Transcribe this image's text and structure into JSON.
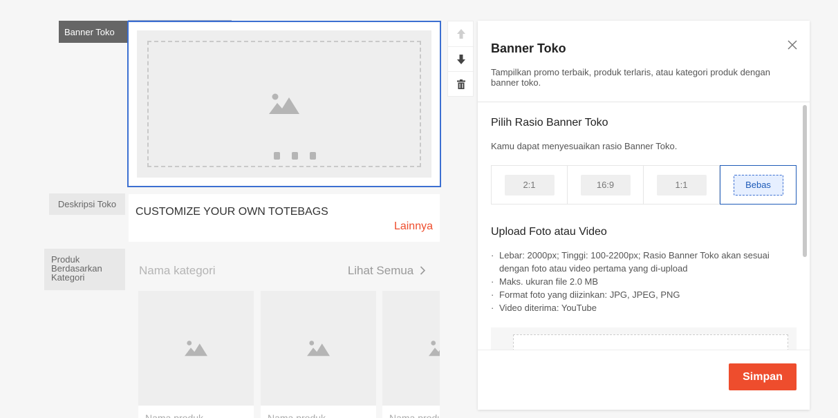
{
  "side_labels": {
    "banner": "Banner Toko",
    "description": "Deskripsi Toko",
    "products": "Produk\nBerdasarkan\nKategori"
  },
  "toolbar": {
    "up_icon": "arrow-up-icon",
    "down_icon": "arrow-down-icon",
    "delete_icon": "trash-icon"
  },
  "description_block": {
    "title": "CUSTOMIZE YOUR OWN TOTEBAGS",
    "more_link": "Lainnya"
  },
  "product_block": {
    "category_name": "Nama kategori",
    "see_all": "Lihat Semua",
    "products": [
      {
        "name": "Nama produk"
      },
      {
        "name": "Nama produk"
      },
      {
        "name": "Nama produk"
      }
    ]
  },
  "modal": {
    "title": "Banner Toko",
    "subtitle": "Tampilkan promo terbaik, produk terlaris, atau kategori produk dengan banner toko.",
    "ratio_section": {
      "title": "Pilih Rasio Banner Toko",
      "description": "Kamu dapat menyesuaikan rasio Banner Toko.",
      "options": [
        {
          "label": "2:1",
          "selected": false
        },
        {
          "label": "16:9",
          "selected": false
        },
        {
          "label": "1:1",
          "selected": false
        },
        {
          "label": "Bebas",
          "selected": true
        }
      ]
    },
    "upload_section": {
      "title": "Upload Foto atau Video",
      "rules": [
        "Lebar: 2000px; Tinggi: 100-2200px; Rasio Banner Toko akan sesuai dengan foto atau video pertama yang di-upload",
        "Maks. ukuran file 2.0 MB",
        "Format foto yang diizinkan: JPG, JPEG, PNG",
        "Video diterima: YouTube"
      ]
    },
    "save_label": "Simpan"
  },
  "colors": {
    "accent": "#ee4d2d",
    "selection_blue": "#3c6fd1"
  }
}
